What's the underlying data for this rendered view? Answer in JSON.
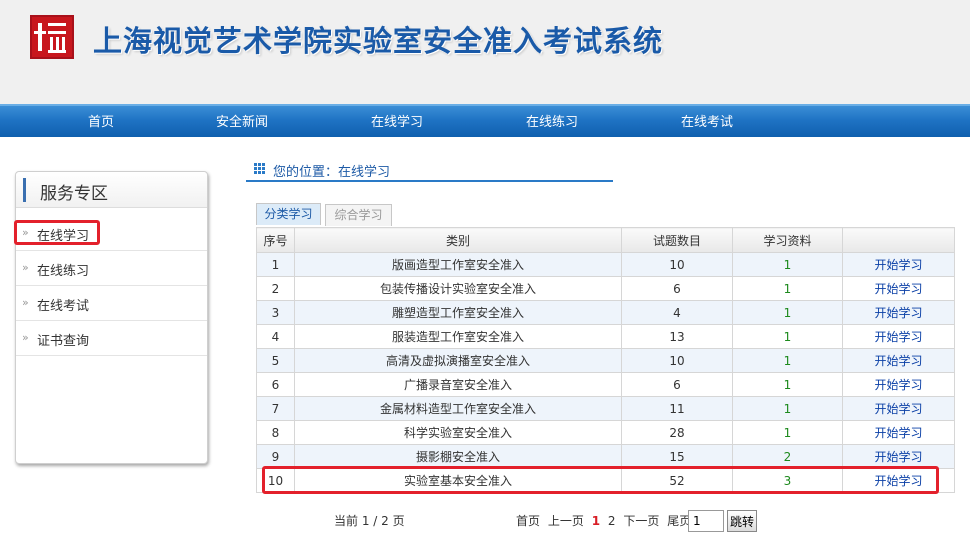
{
  "header": {
    "logo_icon": "school-seal-icon",
    "title": "上海视觉艺术学院实验室安全准入考试系统"
  },
  "nav": {
    "items": [
      "首页",
      "安全新闻",
      "在线学习",
      "在线练习",
      "在线考试"
    ]
  },
  "sidebar": {
    "title": "服务专区",
    "items": [
      "在线学习",
      "在线练习",
      "在线考试",
      "证书查询"
    ],
    "selected": "在线学习"
  },
  "breadcrumb": {
    "text": "您的位置：在线学习"
  },
  "tabs": {
    "items": [
      "分类学习",
      "综合学习"
    ],
    "active": "分类学习"
  },
  "table": {
    "headers": [
      "序号",
      "类别",
      "试题数目",
      "学习资料",
      ""
    ],
    "rows": [
      {
        "no": "1",
        "category": "版画造型工作室安全准入",
        "count": "10",
        "materials": "1",
        "action": "开始学习"
      },
      {
        "no": "2",
        "category": "包装传播设计实验室安全准入",
        "count": "6",
        "materials": "1",
        "action": "开始学习"
      },
      {
        "no": "3",
        "category": "雕塑造型工作室安全准入",
        "count": "4",
        "materials": "1",
        "action": "开始学习"
      },
      {
        "no": "4",
        "category": "服装造型工作室安全准入",
        "count": "13",
        "materials": "1",
        "action": "开始学习"
      },
      {
        "no": "5",
        "category": "高清及虚拟演播室安全准入",
        "count": "10",
        "materials": "1",
        "action": "开始学习"
      },
      {
        "no": "6",
        "category": "广播录音室安全准入",
        "count": "6",
        "materials": "1",
        "action": "开始学习"
      },
      {
        "no": "7",
        "category": "金属材料造型工作室安全准入",
        "count": "11",
        "materials": "1",
        "action": "开始学习"
      },
      {
        "no": "8",
        "category": "科学实验室安全准入",
        "count": "28",
        "materials": "1",
        "action": "开始学习"
      },
      {
        "no": "9",
        "category": "摄影棚安全准入",
        "count": "15",
        "materials": "2",
        "action": "开始学习"
      },
      {
        "no": "10",
        "category": "实验室基本安全准入",
        "count": "52",
        "materials": "3",
        "action": "开始学习"
      }
    ]
  },
  "pager": {
    "info": "当前 1 / 2 页",
    "first": "首页",
    "prev": "上一页",
    "pages": [
      "1",
      "2"
    ],
    "current": "1",
    "next": "下一页",
    "last": "尾页",
    "input_value": "1",
    "go_label": "跳转"
  },
  "colors": {
    "nav_blue": "#1f73c4",
    "title_blue": "#1a5aa8",
    "highlight_red": "#e3202b",
    "materials_green": "#1d8a1d",
    "link_blue": "#0a3fa6"
  }
}
